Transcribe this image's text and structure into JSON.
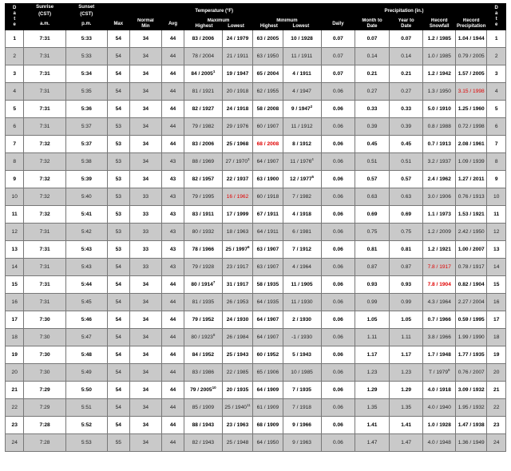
{
  "header": {
    "day_letters": [
      "D",
      "a",
      "t",
      "e"
    ],
    "sunrise": "Sunrise",
    "sunset": "Sunset",
    "cst": "(CST)",
    "am": "a.m.",
    "pm": "p.m.",
    "temperature": "Temperature (°F)",
    "normal": "Normal",
    "maximum": "Maximum",
    "minimum": "Minimum",
    "max": "Max",
    "min": "Min",
    "avg": "Avg",
    "highest": "Highest",
    "lowest": "Lowest",
    "precipitation": "Precipitation (in.)",
    "daily": "Daily",
    "month_to": "Month to",
    "year_to": "Year to",
    "date": "Date",
    "record": "Record",
    "snowfall": "Snowfall",
    "record_precipitation": "Precipitation"
  },
  "rows": [
    {
      "day": "1",
      "sunrise": "7:31",
      "sunset": "5:33",
      "nmax": "54",
      "nmin": "34",
      "avg": "44",
      "maxhigh": "83 / 2006",
      "maxlow": "24 / 1979",
      "minhigh": "63 / 2005",
      "minlow": "10 / 1928",
      "daily": "0.07",
      "mtd": "0.07",
      "ytd": "0.07",
      "snow": "1.2 / 1985",
      "precip": "1.04 / 1944"
    },
    {
      "day": "2",
      "sunrise": "7:31",
      "sunset": "5:33",
      "nmax": "54",
      "nmin": "34",
      "avg": "44",
      "maxhigh": "78 / 2004",
      "maxlow": "21 / 1911",
      "minhigh": "63 / 1950",
      "minlow": "11 / 1911",
      "daily": "0.07",
      "mtd": "0.14",
      "ytd": "0.14",
      "snow": "1.0 / 1985",
      "precip": "0.79 / 2005"
    },
    {
      "day": "3",
      "sunrise": "7:31",
      "sunset": "5:34",
      "nmax": "54",
      "nmin": "34",
      "avg": "44",
      "maxhigh": "84 / 2005",
      "maxhigh_sup": "1",
      "maxlow": "19 / 1947",
      "minhigh": "65 / 2004",
      "minlow": "4 / 1911",
      "daily": "0.07",
      "mtd": "0.21",
      "ytd": "0.21",
      "snow": "1.2 / 1942",
      "precip": "1.57 / 2005"
    },
    {
      "day": "4",
      "sunrise": "7:31",
      "sunset": "5:35",
      "nmax": "54",
      "nmin": "34",
      "avg": "44",
      "maxhigh": "81 / 1921",
      "maxlow": "20 / 1918",
      "minhigh": "62 / 1955",
      "minlow": "4 / 1947",
      "daily": "0.06",
      "mtd": "0.27",
      "ytd": "0.27",
      "snow": "1.3 / 1950",
      "precip": "3.15 / 1998",
      "precip_red": true
    },
    {
      "day": "5",
      "sunrise": "7:31",
      "sunset": "5:36",
      "nmax": "54",
      "nmin": "34",
      "avg": "44",
      "maxhigh": "82 / 1927",
      "maxlow": "24 / 1918",
      "minhigh": "58 / 2008",
      "minlow": "9 / 1947",
      "minlow_sup": "2",
      "daily": "0.06",
      "mtd": "0.33",
      "ytd": "0.33",
      "snow": "5.0 / 1910",
      "precip": "1.25 / 1960"
    },
    {
      "day": "6",
      "sunrise": "7:31",
      "sunset": "5:37",
      "nmax": "53",
      "nmin": "34",
      "avg": "44",
      "maxhigh": "79 / 1982",
      "maxlow": "29 / 1976",
      "minhigh": "60 / 1907",
      "minlow": "11 / 1912",
      "daily": "0.06",
      "mtd": "0.39",
      "ytd": "0.39",
      "snow": "0.8 / 1988",
      "precip": "0.72 / 1998"
    },
    {
      "day": "7",
      "sunrise": "7:32",
      "sunset": "5:37",
      "nmax": "53",
      "nmin": "34",
      "avg": "44",
      "maxhigh": "83 / 2006",
      "maxlow": "25 / 1968",
      "minhigh": "68 / 2008",
      "minhigh_red": true,
      "minlow": "8 / 1912",
      "daily": "0.06",
      "mtd": "0.45",
      "ytd": "0.45",
      "snow": "0.7 / 1913",
      "precip": "2.08 / 1961"
    },
    {
      "day": "8",
      "sunrise": "7:32",
      "sunset": "5:38",
      "nmax": "53",
      "nmin": "34",
      "avg": "43",
      "maxhigh": "88 / 1969",
      "maxlow": "27 / 1970",
      "maxlow_sup": "3",
      "minhigh": "64 / 1907",
      "minlow": "11 / 1976",
      "minlow_sup": "4",
      "daily": "0.06",
      "mtd": "0.51",
      "ytd": "0.51",
      "snow": "3.2 / 1937",
      "precip": "1.09 / 1939"
    },
    {
      "day": "9",
      "sunrise": "7:32",
      "sunset": "5:39",
      "nmax": "53",
      "nmin": "34",
      "avg": "43",
      "maxhigh": "82 / 1957",
      "maxlow": "22 / 1937",
      "minhigh": "63 / 1900",
      "minlow": "12 / 1977",
      "minlow_sup": "5",
      "daily": "0.06",
      "mtd": "0.57",
      "ytd": "0.57",
      "snow": "2.4 / 1962",
      "precip": "1.27 / 2011"
    },
    {
      "day": "10",
      "sunrise": "7:32",
      "sunset": "5:40",
      "nmax": "53",
      "nmin": "33",
      "avg": "43",
      "maxhigh": "79 / 1995",
      "maxlow": "16 / 1962",
      "maxlow_red": true,
      "minhigh": "60 / 1918",
      "minlow": "7 / 1982",
      "daily": "0.06",
      "mtd": "0.63",
      "ytd": "0.63",
      "snow": "3.0 / 1906",
      "precip": "0.76 / 1913"
    },
    {
      "day": "11",
      "sunrise": "7:32",
      "sunset": "5:41",
      "nmax": "53",
      "nmin": "33",
      "avg": "43",
      "maxhigh": "83 / 1911",
      "maxlow": "17 / 1999",
      "minhigh": "67 / 1911",
      "minlow": "4 / 1918",
      "daily": "0.06",
      "mtd": "0.69",
      "ytd": "0.69",
      "snow": "1.1 / 1973",
      "precip": "1.53 / 1921"
    },
    {
      "day": "12",
      "sunrise": "7:31",
      "sunset": "5:42",
      "nmax": "53",
      "nmin": "33",
      "avg": "43",
      "maxhigh": "80 / 1932",
      "maxlow": "18 / 1963",
      "minhigh": "64 / 1911",
      "minlow": "6 / 1981",
      "daily": "0.06",
      "mtd": "0.75",
      "ytd": "0.75",
      "snow": "1.2 / 2009",
      "precip": "2.42 / 1950"
    },
    {
      "day": "13",
      "sunrise": "7:31",
      "sunset": "5:43",
      "nmax": "53",
      "nmin": "33",
      "avg": "43",
      "maxhigh": "78 / 1966",
      "maxlow": "25 / 1997",
      "maxlow_sup": "6",
      "minhigh": "63 / 1907",
      "minlow": "7 / 1912",
      "daily": "0.06",
      "mtd": "0.81",
      "ytd": "0.81",
      "snow": "1.2 / 1921",
      "precip": "1.00 / 2007"
    },
    {
      "day": "14",
      "sunrise": "7:31",
      "sunset": "5:43",
      "nmax": "54",
      "nmin": "33",
      "avg": "43",
      "maxhigh": "79 / 1928",
      "maxlow": "23 / 1917",
      "minhigh": "63 / 1907",
      "minlow": "4 / 1964",
      "daily": "0.06",
      "mtd": "0.87",
      "ytd": "0.87",
      "snow": "7.8 / 1917",
      "snow_red": true,
      "precip": "0.78 / 1917"
    },
    {
      "day": "15",
      "sunrise": "7:31",
      "sunset": "5:44",
      "nmax": "54",
      "nmin": "34",
      "avg": "44",
      "maxhigh": "80 / 1914",
      "maxhigh_sup": "7",
      "maxlow": "31 / 1917",
      "minhigh": "58 / 1935",
      "minlow": "11 / 1905",
      "daily": "0.06",
      "mtd": "0.93",
      "ytd": "0.93",
      "snow": "7.8 / 1904",
      "snow_red": true,
      "precip": "0.82 / 1904"
    },
    {
      "day": "16",
      "sunrise": "7:31",
      "sunset": "5:45",
      "nmax": "54",
      "nmin": "34",
      "avg": "44",
      "maxhigh": "81 / 1935",
      "maxlow": "26 / 1953",
      "minhigh": "64 / 1935",
      "minlow": "11 / 1930",
      "daily": "0.06",
      "mtd": "0.99",
      "ytd": "0.99",
      "snow": "4.3 / 1964",
      "precip": "2.27 / 2004"
    },
    {
      "day": "17",
      "sunrise": "7:30",
      "sunset": "5:46",
      "nmax": "54",
      "nmin": "34",
      "avg": "44",
      "maxhigh": "79 / 1952",
      "maxlow": "24 / 1930",
      "minhigh": "64 / 1907",
      "minlow": "2 / 1930",
      "daily": "0.06",
      "mtd": "1.05",
      "ytd": "1.05",
      "snow": "0.7 / 1966",
      "precip": "0.59 / 1995"
    },
    {
      "day": "18",
      "sunrise": "7:30",
      "sunset": "5:47",
      "nmax": "54",
      "nmin": "34",
      "avg": "44",
      "maxhigh": "80 / 1923",
      "maxhigh_sup": "8",
      "maxlow": "26 / 1984",
      "minhigh": "64 / 1907",
      "minlow": "-1 / 1930",
      "daily": "0.06",
      "mtd": "1.11",
      "ytd": "1.11",
      "snow": "3.8 / 1966",
      "precip": "1.99 / 1990"
    },
    {
      "day": "19",
      "sunrise": "7:30",
      "sunset": "5:48",
      "nmax": "54",
      "nmin": "34",
      "avg": "44",
      "maxhigh": "84 / 1952",
      "maxlow": "25 / 1943",
      "minhigh": "60 / 1952",
      "minlow": "5 / 1943",
      "daily": "0.06",
      "mtd": "1.17",
      "ytd": "1.17",
      "snow": "1.7 / 1948",
      "precip": "1.77 / 1935"
    },
    {
      "day": "20",
      "sunrise": "7:30",
      "sunset": "5:49",
      "nmax": "54",
      "nmin": "34",
      "avg": "44",
      "maxhigh": "83 / 1986",
      "maxlow": "22 / 1985",
      "minhigh": "65 / 1906",
      "minlow": "10 / 1985",
      "daily": "0.06",
      "mtd": "1.23",
      "ytd": "1.23",
      "snow": "T / 1979",
      "snow_sup": "9",
      "precip": "0.76 / 2007"
    },
    {
      "day": "21",
      "sunrise": "7:29",
      "sunset": "5:50",
      "nmax": "54",
      "nmin": "34",
      "avg": "44",
      "maxhigh": "79 / 2005",
      "maxhigh_sup": "10",
      "maxlow": "20 / 1935",
      "minhigh": "64 / 1909",
      "minlow": "7 / 1935",
      "daily": "0.06",
      "mtd": "1.29",
      "ytd": "1.29",
      "snow": "4.0 / 1918",
      "precip": "3.09 / 1932"
    },
    {
      "day": "22",
      "sunrise": "7:29",
      "sunset": "5:51",
      "nmax": "54",
      "nmin": "34",
      "avg": "44",
      "maxhigh": "85 / 1909",
      "maxlow": "25 / 1940",
      "maxlow_sup": "11",
      "minhigh": "61 / 1909",
      "minlow": "7 / 1918",
      "daily": "0.06",
      "mtd": "1.35",
      "ytd": "1.35",
      "snow": "4.0 / 1940",
      "precip": "1.95 / 1932"
    },
    {
      "day": "23",
      "sunrise": "7:28",
      "sunset": "5:52",
      "nmax": "54",
      "nmin": "34",
      "avg": "44",
      "maxhigh": "88 / 1943",
      "maxlow": "23 / 1963",
      "minhigh": "68 / 1909",
      "minlow": "9 / 1966",
      "daily": "0.06",
      "mtd": "1.41",
      "ytd": "1.41",
      "snow": "1.0 / 1928",
      "precip": "1.47 / 1938"
    },
    {
      "day": "24",
      "sunrise": "7:28",
      "sunset": "5:53",
      "nmax": "55",
      "nmin": "34",
      "avg": "44",
      "maxhigh": "82 / 1943",
      "maxlow": "25 / 1948",
      "minhigh": "64 / 1950",
      "minlow": "9 / 1963",
      "daily": "0.06",
      "mtd": "1.47",
      "ytd": "1.47",
      "snow": "4.0 / 1948",
      "precip": "1.36 / 1949"
    }
  ]
}
